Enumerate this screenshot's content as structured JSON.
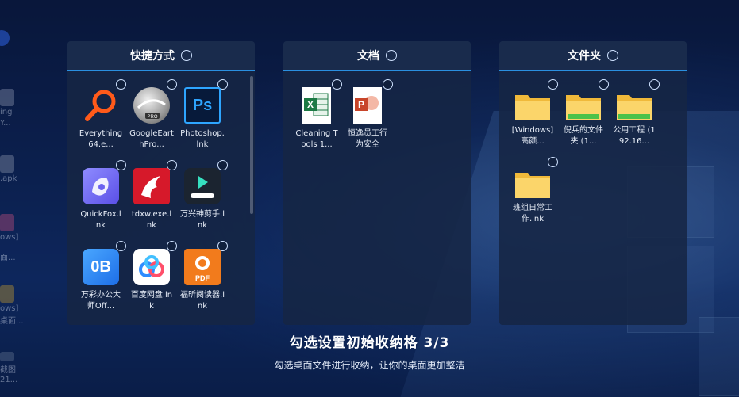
{
  "panels": [
    {
      "title": "快捷方式",
      "items": [
        {
          "label": "Everything64.e...",
          "icon": "everything-icon"
        },
        {
          "label": "GoogleEarthPro...",
          "icon": "google-earth-pro-icon"
        },
        {
          "label": "Photoshop.lnk",
          "icon": "photoshop-icon",
          "glyph": "Ps"
        },
        {
          "label": "QuickFox.lnk",
          "icon": "quickfox-icon"
        },
        {
          "label": "tdxw.exe.lnk",
          "icon": "tdxw-icon"
        },
        {
          "label": "万兴神剪手.lnk",
          "icon": "wondershare-filmora-icon"
        },
        {
          "label": "万彩办公大师Off...",
          "icon": "wancai-office-icon",
          "glyph": "0B"
        },
        {
          "label": "百度网盘.lnk",
          "icon": "baidu-netdisk-icon"
        },
        {
          "label": "福昕阅读器.lnk",
          "icon": "foxit-reader-icon",
          "glyph": "PDF"
        }
      ]
    },
    {
      "title": "文档",
      "items": [
        {
          "label": "Cleaning Tools 1...",
          "icon": "excel-file-icon"
        },
        {
          "label": "恒逸员工行为安全",
          "icon": "powerpoint-file-icon"
        }
      ]
    },
    {
      "title": "文件夹",
      "items": [
        {
          "label": "[Windows] 高颜...",
          "icon": "folder-icon"
        },
        {
          "label": "倪兵的文件夹 (1...",
          "icon": "shared-folder-icon"
        },
        {
          "label": "公用工程 (192.16...",
          "icon": "shared-folder-icon"
        },
        {
          "label": "班组日常工作.lnk",
          "icon": "folder-icon"
        }
      ]
    }
  ],
  "footer": {
    "title": "勾选设置初始收纳格 3/3",
    "subtitle": "勾选桌面文件进行收纳，让你的桌面更加整洁"
  },
  "ghost_desktop": [
    "ing",
    "Y...",
    ".apk",
    "ows]",
    "面...",
    "ows]",
    "桌面...",
    "截图",
    "21..."
  ],
  "colors": {
    "accent": "#2a8fe0",
    "panel_bg": "#16264a",
    "folder": "#f5c542",
    "shared_folder_bar": "#4cc24a"
  }
}
